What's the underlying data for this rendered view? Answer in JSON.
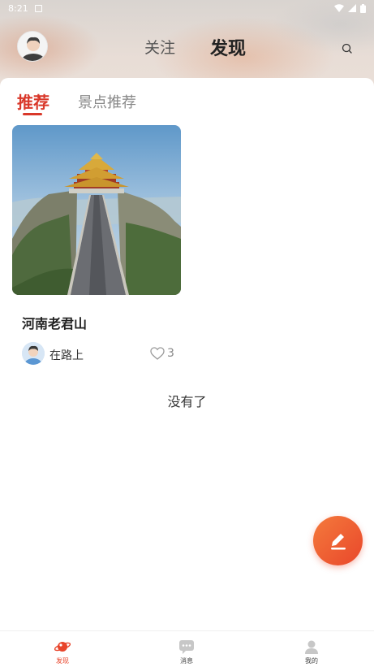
{
  "status_bar": {
    "time": "8:21"
  },
  "top_nav": {
    "tabs": [
      {
        "label": "关注",
        "active": false
      },
      {
        "label": "发现",
        "active": true
      }
    ]
  },
  "sub_tabs": [
    {
      "label": "推荐",
      "active": true
    },
    {
      "label": "景点推荐",
      "active": false
    }
  ],
  "posts": [
    {
      "title": "河南老君山",
      "author": "在路上",
      "likes": "3"
    }
  ],
  "end_text": "没有了",
  "bottom_nav": {
    "items": [
      {
        "label": "发现",
        "icon": "planet-icon",
        "active": true
      },
      {
        "label": "消息",
        "icon": "message-icon",
        "active": false
      },
      {
        "label": "我的",
        "icon": "user-icon",
        "active": false
      }
    ]
  },
  "colors": {
    "accent": "#d9382a",
    "fab_start": "#f47a3c",
    "fab_end": "#e9472b"
  }
}
